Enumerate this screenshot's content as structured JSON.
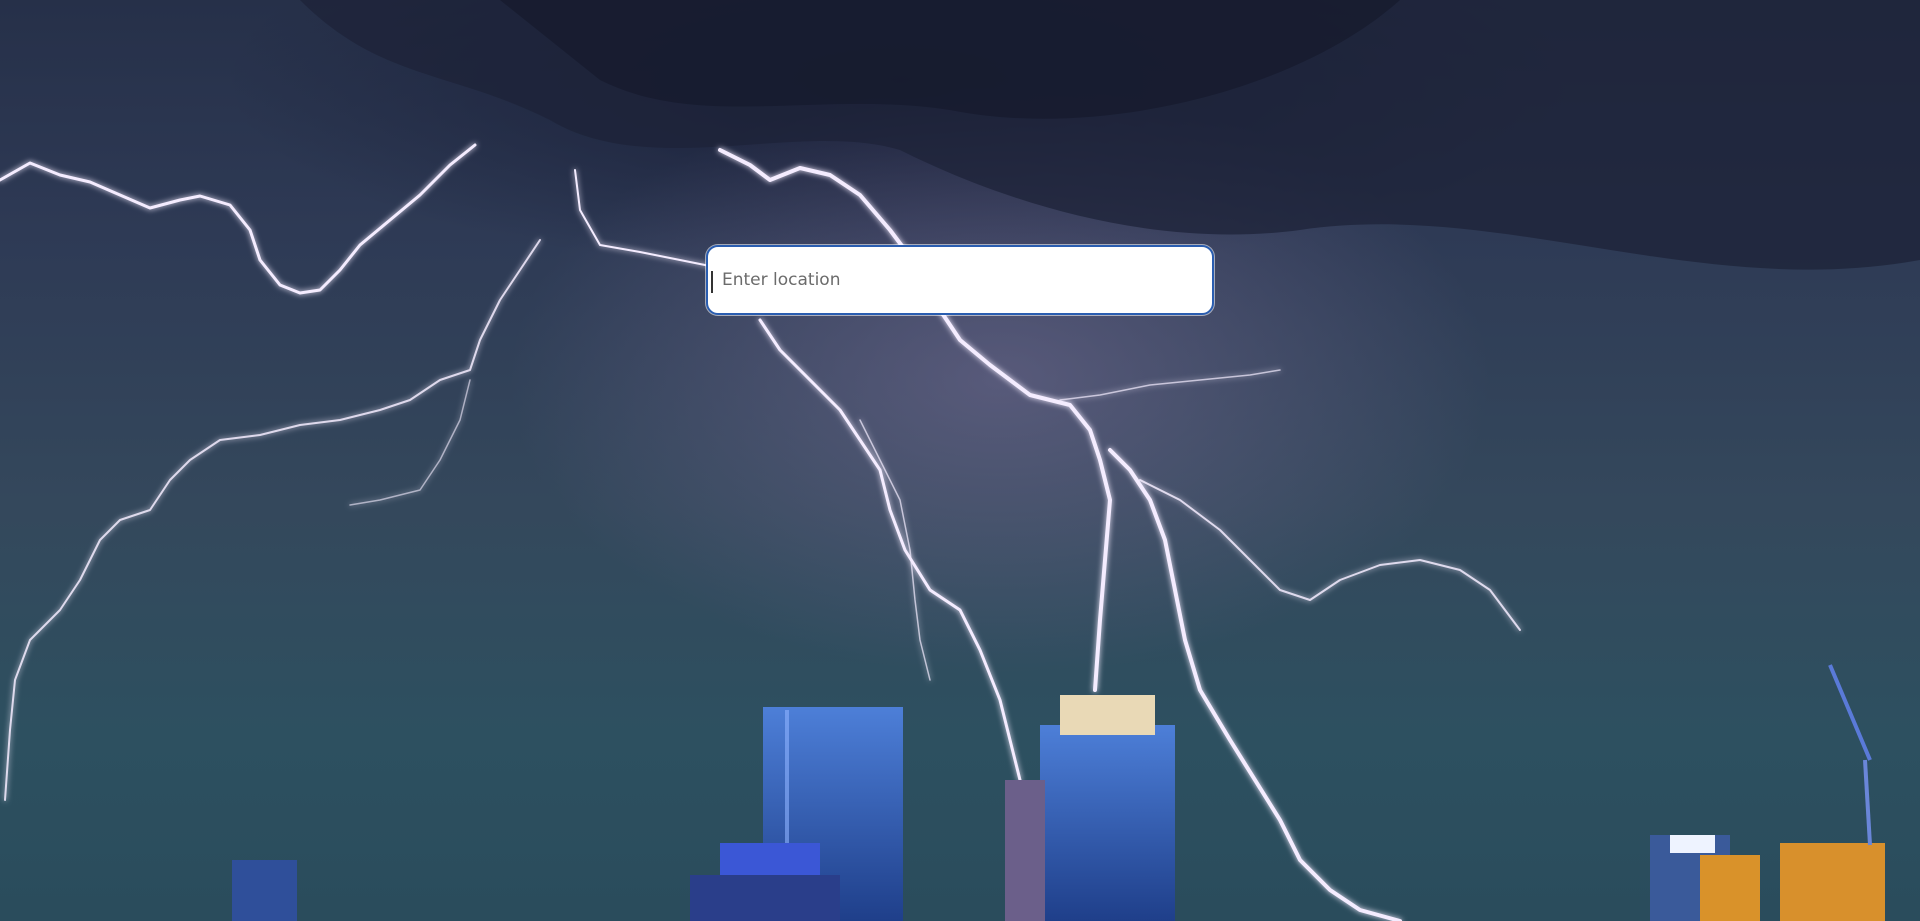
{
  "search": {
    "placeholder": "Enter location",
    "value": ""
  },
  "background": {
    "scene": "night-city-lightning"
  },
  "colors": {
    "input_border": "#2a5db0",
    "sky_top": "#263049",
    "sky_bottom": "#2a4c5c"
  }
}
